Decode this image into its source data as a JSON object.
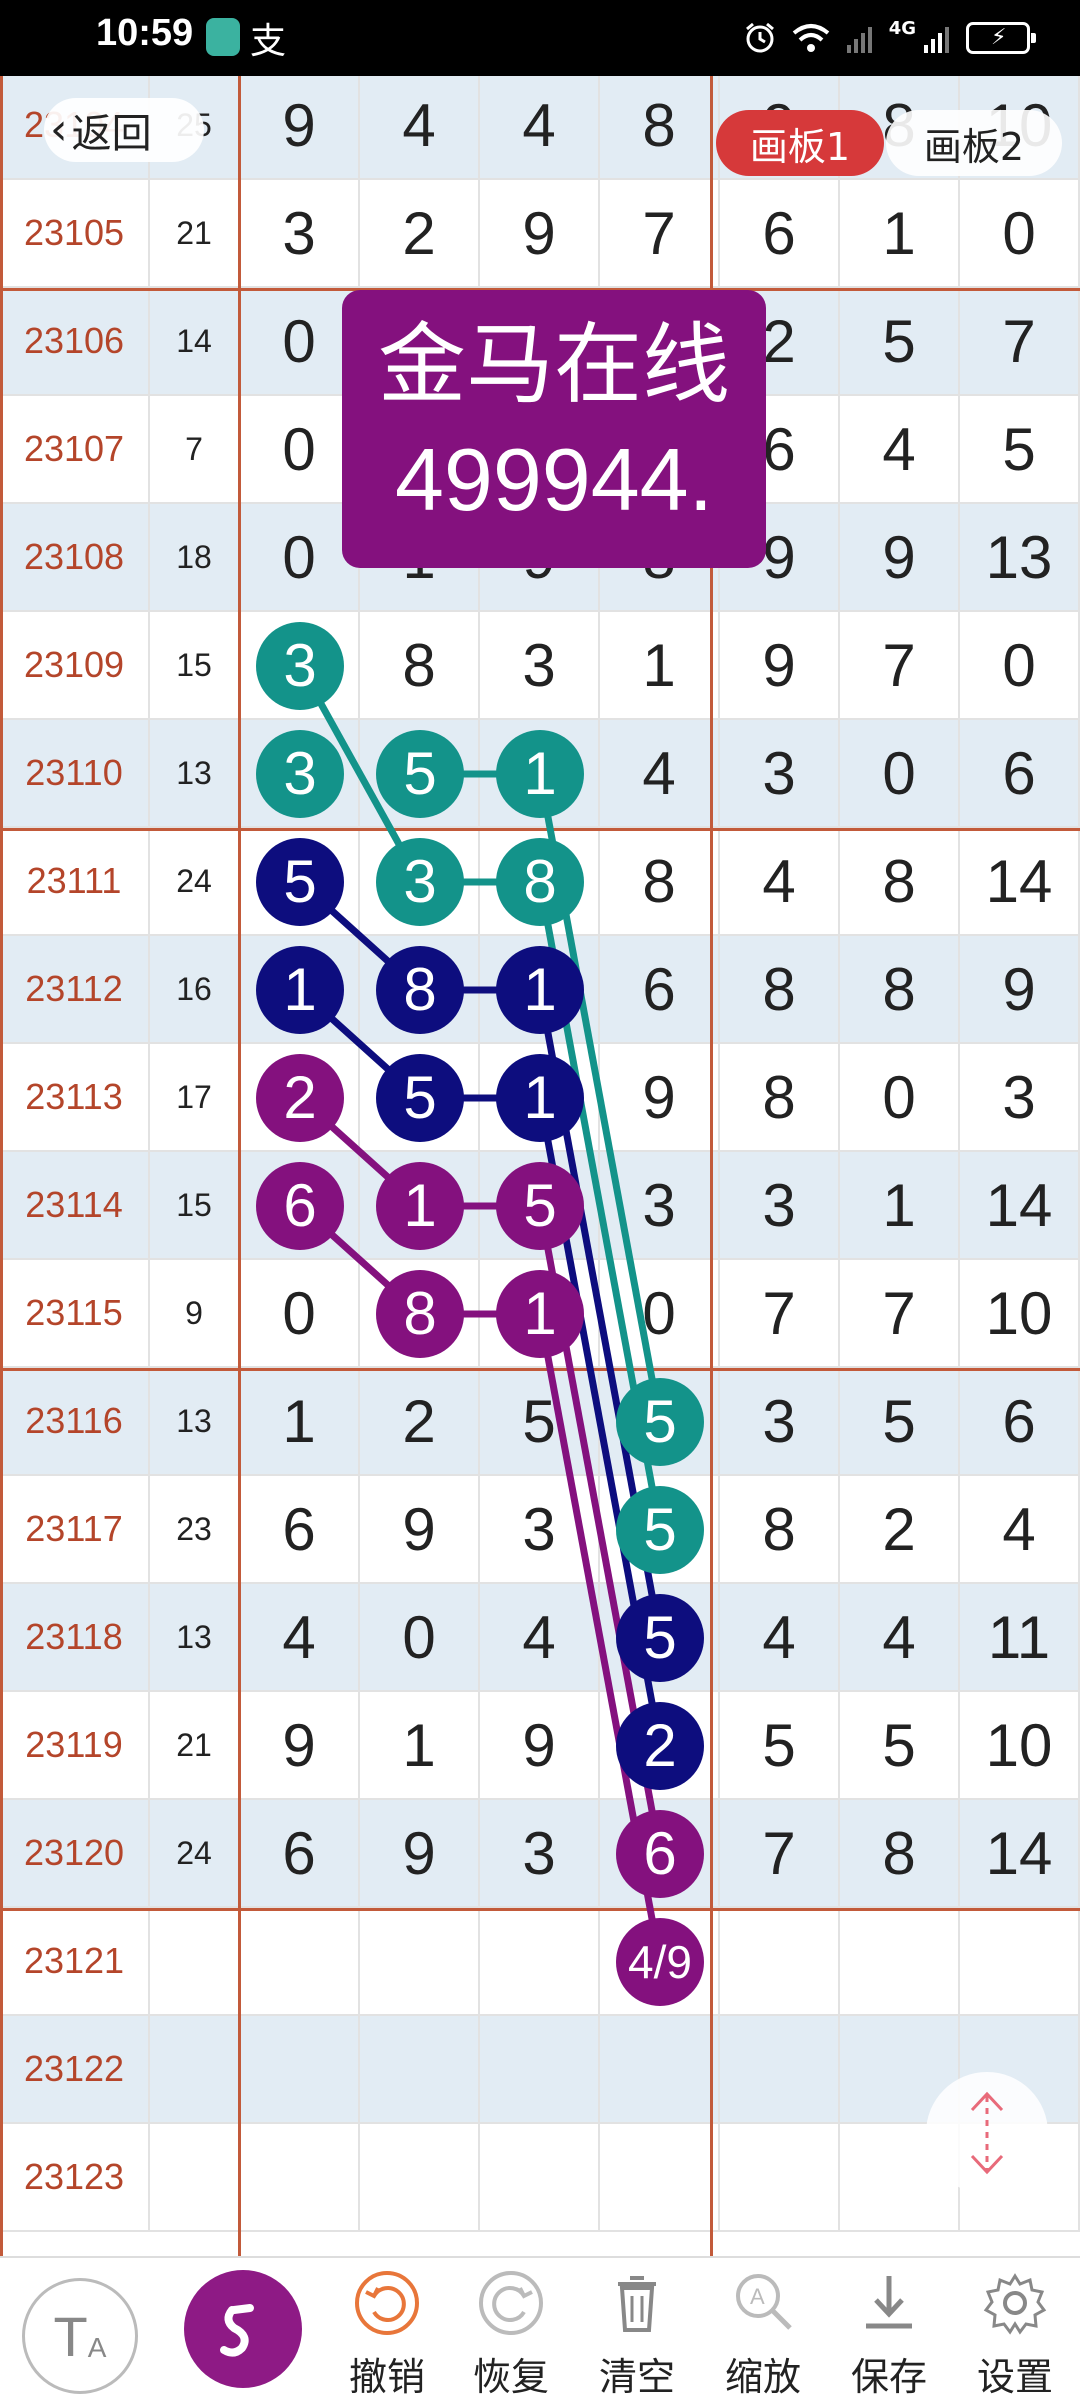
{
  "status_bar": {
    "time": "10:59",
    "notification_glyph": "支",
    "network_label": "4G"
  },
  "header": {
    "back_label": "返回",
    "tabs": [
      {
        "label": "画板1",
        "active": true,
        "color": "#d6393a"
      },
      {
        "label": "画板2",
        "active": false
      }
    ]
  },
  "watermark": {
    "line1": "金马在线",
    "line2": "499944."
  },
  "table": {
    "rows": [
      {
        "issue": "23104",
        "sum": "25",
        "nums": [
          "9",
          "4",
          "4",
          "8",
          "9",
          "8",
          "10"
        ]
      },
      {
        "issue": "23105",
        "sum": "21",
        "nums": [
          "3",
          "2",
          "9",
          "7",
          "6",
          "1",
          "0"
        ]
      },
      {
        "issue": "23106",
        "sum": "14",
        "nums": [
          "0",
          "",
          "",
          "",
          "2",
          "5",
          "7"
        ]
      },
      {
        "issue": "23107",
        "sum": "7",
        "nums": [
          "0",
          "",
          "",
          "",
          "6",
          "4",
          "5"
        ]
      },
      {
        "issue": "23108",
        "sum": "18",
        "nums": [
          "0",
          "1",
          "9",
          "8",
          "9",
          "9",
          "13"
        ]
      },
      {
        "issue": "23109",
        "sum": "15",
        "nums": [
          "3",
          "8",
          "3",
          "1",
          "9",
          "7",
          "0"
        ]
      },
      {
        "issue": "23110",
        "sum": "13",
        "nums": [
          "3",
          "5",
          "1",
          "4",
          "3",
          "0",
          "6"
        ]
      },
      {
        "issue": "23111",
        "sum": "24",
        "nums": [
          "5",
          "3",
          "8",
          "8",
          "4",
          "8",
          "14"
        ]
      },
      {
        "issue": "23112",
        "sum": "16",
        "nums": [
          "1",
          "8",
          "1",
          "6",
          "8",
          "8",
          "9"
        ]
      },
      {
        "issue": "23113",
        "sum": "17",
        "nums": [
          "2",
          "5",
          "1",
          "9",
          "8",
          "0",
          "3"
        ]
      },
      {
        "issue": "23114",
        "sum": "15",
        "nums": [
          "6",
          "1",
          "5",
          "3",
          "3",
          "1",
          "14"
        ]
      },
      {
        "issue": "23115",
        "sum": "9",
        "nums": [
          "0",
          "8",
          "1",
          "0",
          "7",
          "7",
          "10"
        ]
      },
      {
        "issue": "23116",
        "sum": "13",
        "nums": [
          "1",
          "2",
          "5",
          "5",
          "3",
          "5",
          "6"
        ]
      },
      {
        "issue": "23117",
        "sum": "23",
        "nums": [
          "6",
          "9",
          "3",
          "5",
          "8",
          "2",
          "4"
        ]
      },
      {
        "issue": "23118",
        "sum": "13",
        "nums": [
          "4",
          "0",
          "4",
          "5",
          "4",
          "4",
          "11"
        ]
      },
      {
        "issue": "23119",
        "sum": "21",
        "nums": [
          "9",
          "1",
          "9",
          "2",
          "5",
          "5",
          "10"
        ]
      },
      {
        "issue": "23120",
        "sum": "24",
        "nums": [
          "6",
          "9",
          "3",
          "6",
          "7",
          "8",
          "14"
        ]
      },
      {
        "issue": "23121",
        "sum": "",
        "nums": [
          "",
          "",
          "",
          "4/9",
          "",
          "",
          ""
        ]
      },
      {
        "issue": "23122",
        "sum": "",
        "nums": [
          "",
          "",
          "",
          "",
          "",
          "",
          ""
        ]
      },
      {
        "issue": "23123",
        "sum": "",
        "nums": [
          "",
          "",
          "",
          "",
          "",
          "",
          ""
        ]
      }
    ]
  },
  "colors": {
    "teal": "#13938a",
    "navy": "#0d0d7e",
    "purple": "#84117e",
    "issue_text": "#b4452a",
    "grid_line": "#c25a3a",
    "row_alt": "#e2ecf4"
  },
  "toolbar": {
    "text_tool_label": "T",
    "text_tool_sub": "A",
    "items": [
      {
        "label": "撤销",
        "icon": "undo-icon"
      },
      {
        "label": "恢复",
        "icon": "redo-icon"
      },
      {
        "label": "清空",
        "icon": "trash-icon"
      },
      {
        "label": "缩放",
        "icon": "zoom-icon"
      },
      {
        "label": "保存",
        "icon": "download-icon"
      },
      {
        "label": "设置",
        "icon": "gear-icon"
      }
    ]
  }
}
